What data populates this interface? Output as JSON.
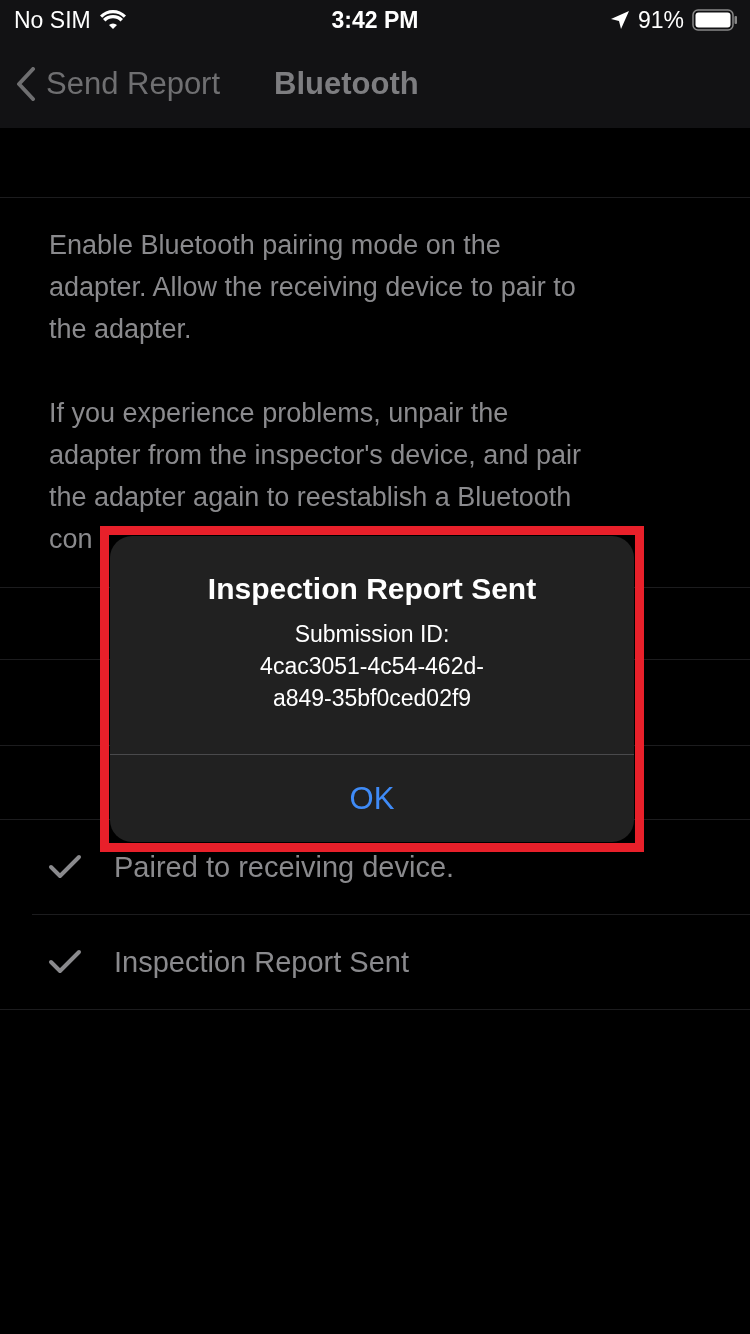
{
  "status_bar": {
    "carrier": "No SIM",
    "time": "3:42 PM",
    "battery": "91%"
  },
  "nav_bar": {
    "back_label": "Send Report",
    "title": "Bluetooth"
  },
  "instructions": [
    "Enable Bluetooth pairing mode on the\nadapter. Allow the receiving device to pair to\nthe adapter.",
    "If you experience problems, unpair the\nadapter from the inspector's device, and pair\nthe adapter again to reestablish a Bluetooth\ncon"
  ],
  "steps": [
    {
      "label": "Paired to receiving device.",
      "checked": true
    },
    {
      "label": "Inspection Report Sent",
      "checked": true
    }
  ],
  "alert": {
    "title": "Inspection Report Sent",
    "message": "Submission ID:\n4cac3051-4c54-462d-\na849-35bf0ced02f9",
    "button": "OK"
  }
}
